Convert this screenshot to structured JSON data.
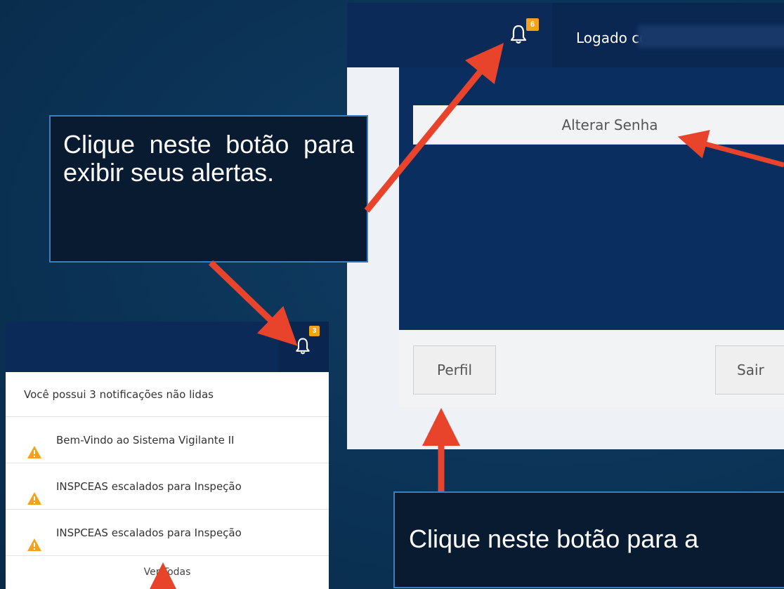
{
  "main": {
    "notification_count": "6",
    "logged_label": "Logado como",
    "alterar_senha_label": "Alterar Senha",
    "perfil_label": "Perfil",
    "sair_label": "Sair"
  },
  "notifications": {
    "count": "3",
    "header": "Você possui 3 notificações não lidas",
    "items": [
      "Bem-Vindo ao Sistema Vigilante II",
      "INSPCEAS escalados para Inspeção",
      "INSPCEAS escalados para Inspeção"
    ],
    "view_all_label": "Ver Todas"
  },
  "callouts": {
    "alerts": "Clique neste botão para exibir seus alertas.",
    "profile": "Clique neste botão para a"
  },
  "colors": {
    "background": "#0b3356",
    "topbar": "#0b2a58",
    "badge": "#f2a21d",
    "arrow": "#e8432b",
    "warning": "#f2a21d"
  }
}
